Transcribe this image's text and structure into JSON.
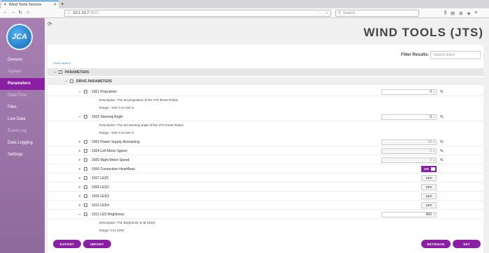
{
  "browser": {
    "tab_title": "Wind Tools Service",
    "tab_close": "✕",
    "new_tab": "+",
    "url_host": "10.1.10.7",
    "url_port": ":3010",
    "url_dots": "···",
    "search_placeholder": "Search",
    "icons": [
      "library-icon",
      "reader-icon",
      "extensions-icon",
      "shield-icon",
      "menu-icon"
    ]
  },
  "sidebar": {
    "logo_text": "JCA",
    "items": [
      {
        "label": "Devices",
        "state": "normal"
      },
      {
        "label": "System",
        "state": "disabled"
      },
      {
        "label": "Parameters",
        "state": "active"
      },
      {
        "label": "Date/Time",
        "state": "disabled"
      },
      {
        "label": "Files",
        "state": "normal"
      },
      {
        "label": "Live Data",
        "state": "normal"
      },
      {
        "label": "Event Log",
        "state": "disabled"
      },
      {
        "label": "Data Logging",
        "state": "normal"
      },
      {
        "label": "Settings",
        "state": "normal"
      }
    ]
  },
  "main": {
    "title": "WIND TOOLS (JTS)",
    "filter_label": "Filter Results:",
    "filter_placeholder": "Search query",
    "show_views": "Show Views ✔",
    "group": "PARAMETERS",
    "subgroup": "DRIVE PARAMETERS",
    "params": [
      {
        "toggle": "−",
        "name": "1001 Propulsion",
        "kind": "number",
        "value": "0",
        "unit": "%",
        "disabled": false,
        "desc": [
          "Description: The set propulsion of the JTS Rover Robot.",
          "Range: -100 % to 100 %"
        ]
      },
      {
        "toggle": "−",
        "name": "1002 Steering Angle",
        "kind": "number",
        "value": "0",
        "unit": "%",
        "disabled": false,
        "desc": [
          "Description: The set steering angle of the JTS Rover Robot.",
          "Range: -100 % to 100 %"
        ]
      },
      {
        "toggle": "+",
        "name": "1003 Power Supply Remaining",
        "kind": "number",
        "value": "42",
        "unit": "%",
        "disabled": true
      },
      {
        "toggle": "+",
        "name": "1004 Left Motor Speed",
        "kind": "number",
        "value": "0",
        "unit": "%",
        "disabled": true
      },
      {
        "toggle": "+",
        "name": "1005 Right Motor Speed",
        "kind": "number",
        "value": "0",
        "unit": "%",
        "disabled": true
      },
      {
        "toggle": "+",
        "name": "1006 Connection HeartBeat",
        "kind": "switch",
        "value": "ON",
        "state": "on"
      },
      {
        "toggle": "+",
        "name": "1007 LED1",
        "kind": "switch",
        "value": "OFF",
        "state": "off"
      },
      {
        "toggle": "+",
        "name": "1008 LED2",
        "kind": "switch",
        "value": "OFF",
        "state": "off"
      },
      {
        "toggle": "+",
        "name": "1009 LED3",
        "kind": "switch",
        "value": "OFF",
        "state": "off"
      },
      {
        "toggle": "+",
        "name": "1010 LED4",
        "kind": "switch",
        "value": "OFF",
        "state": "off"
      },
      {
        "toggle": "−",
        "name": "1011 LED Brightness",
        "kind": "number",
        "value": "400",
        "unit": "",
        "disabled": false,
        "desc": [
          "Description: The Brightness of all LEDs",
          "Range: 0 to 1000"
        ]
      }
    ],
    "buttons": {
      "export": "EXPORT",
      "import": "IMPORT",
      "retrieve": "RETRIEVE",
      "set": "SET"
    }
  }
}
